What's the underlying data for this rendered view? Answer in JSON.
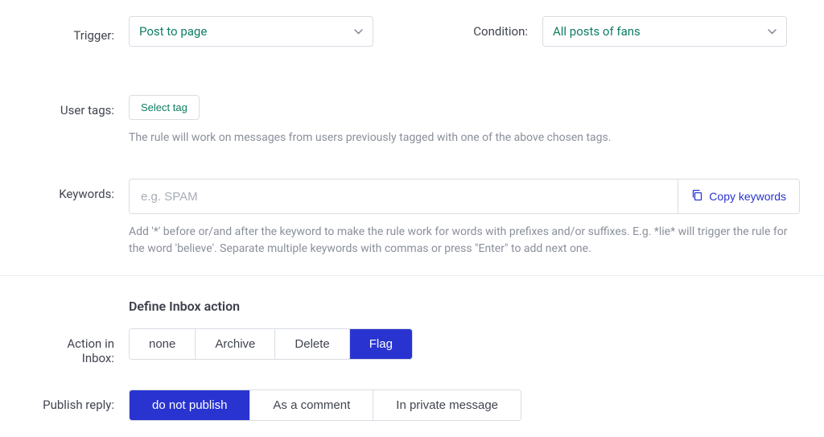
{
  "top": {
    "trigger_label": "Trigger:",
    "trigger_value": "Post to page",
    "condition_label": "Condition:",
    "condition_value": "All posts of fans"
  },
  "tags": {
    "label": "User tags:",
    "select_btn": "Select tag",
    "help": "The rule will work on messages from users previously tagged with one of the above chosen tags."
  },
  "keywords": {
    "label": "Keywords:",
    "placeholder": "e.g. SPAM",
    "copy_btn": "Copy keywords",
    "help": "Add '*' before or/and after the keyword to make the rule work for words with prefixes and/or suffixes. E.g. *lie* will trigger the rule for the word 'believe'. Separate multiple keywords with commas or press \"Enter\" to add next one."
  },
  "inbox": {
    "heading": "Define Inbox action",
    "action_label": "Action in Inbox:",
    "options": {
      "none": "none",
      "archive": "Archive",
      "delete": "Delete",
      "flag": "Flag"
    },
    "publish_label": "Publish reply:",
    "publish_options": {
      "no": "do not publish",
      "comment": "As a comment",
      "pm": "In private message"
    }
  }
}
